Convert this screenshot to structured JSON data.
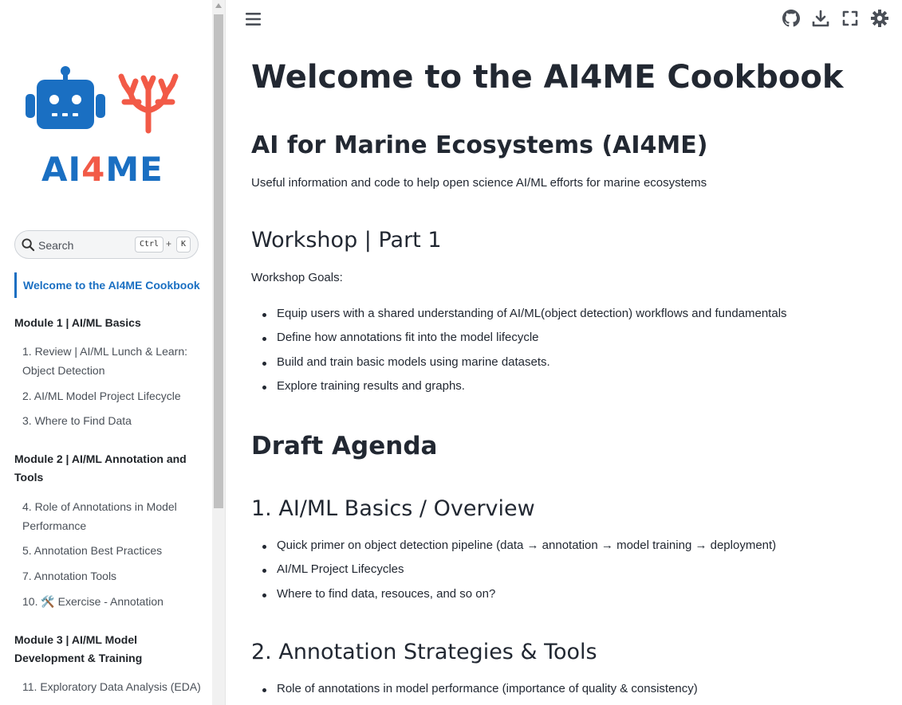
{
  "logo": {
    "text_a": "AI",
    "text_four": "4",
    "text_me": "ME",
    "robot_color": "#1a6fc2",
    "coral_color": "#f25a47"
  },
  "search": {
    "label": "Search",
    "shortcut_ctrl": "Ctrl",
    "shortcut_plus": "+",
    "shortcut_key": "K"
  },
  "sidebar": {
    "active_item": "Welcome to the AI4ME Cookbook",
    "modules": [
      {
        "title": "Module 1 | AI/ML Basics",
        "items": [
          "1. Review | AI/ML Lunch & Learn: Object Detection",
          "2. AI/ML Model Project Lifecycle",
          "3. Where to Find Data"
        ]
      },
      {
        "title": "Module 2 | AI/ML Annotation and Tools",
        "items": [
          "4. Role of Annotations in Model Performance",
          "5. Annotation Best Practices",
          "7. Annotation Tools",
          "10. 🛠️ Exercise - Annotation"
        ]
      },
      {
        "title": "Module 3 | AI/ML Model Development & Training",
        "items": [
          "11. Exploratory Data Analysis (EDA)"
        ]
      }
    ]
  },
  "toolbar": {
    "menu_icon": "hamburger-icon",
    "icons": [
      "github-icon",
      "download-icon",
      "fullscreen-icon",
      "theme-toggle-icon"
    ]
  },
  "content": {
    "title": "Welcome to the AI4ME Cookbook",
    "subtitle": "AI for Marine Ecosystems (AI4ME)",
    "intro": "Useful information and code to help open science AI/ML efforts for marine ecosystems",
    "workshop_heading": "Workshop | Part 1",
    "goals_label": "Workshop Goals:",
    "goals": [
      "Equip users with a shared understanding of AI/ML(object detection) workflows and fundamentals",
      "Define how annotations fit into the model lifecycle",
      "Build and train basic models using marine datasets.",
      "Explore training results and graphs."
    ],
    "agenda_heading": "Draft Agenda",
    "section1_heading": "1. AI/ML Basics / Overview",
    "section1_items": [
      "Quick primer on object detection pipeline (data → annotation → model training → deployment)",
      "AI/ML Project Lifecycles",
      "Where to find data, resouces, and so on?"
    ],
    "section2_heading": "2. Annotation Strategies & Tools",
    "section2_items": [
      "Role of annotations in model performance (importance of quality & consistency)"
    ]
  }
}
